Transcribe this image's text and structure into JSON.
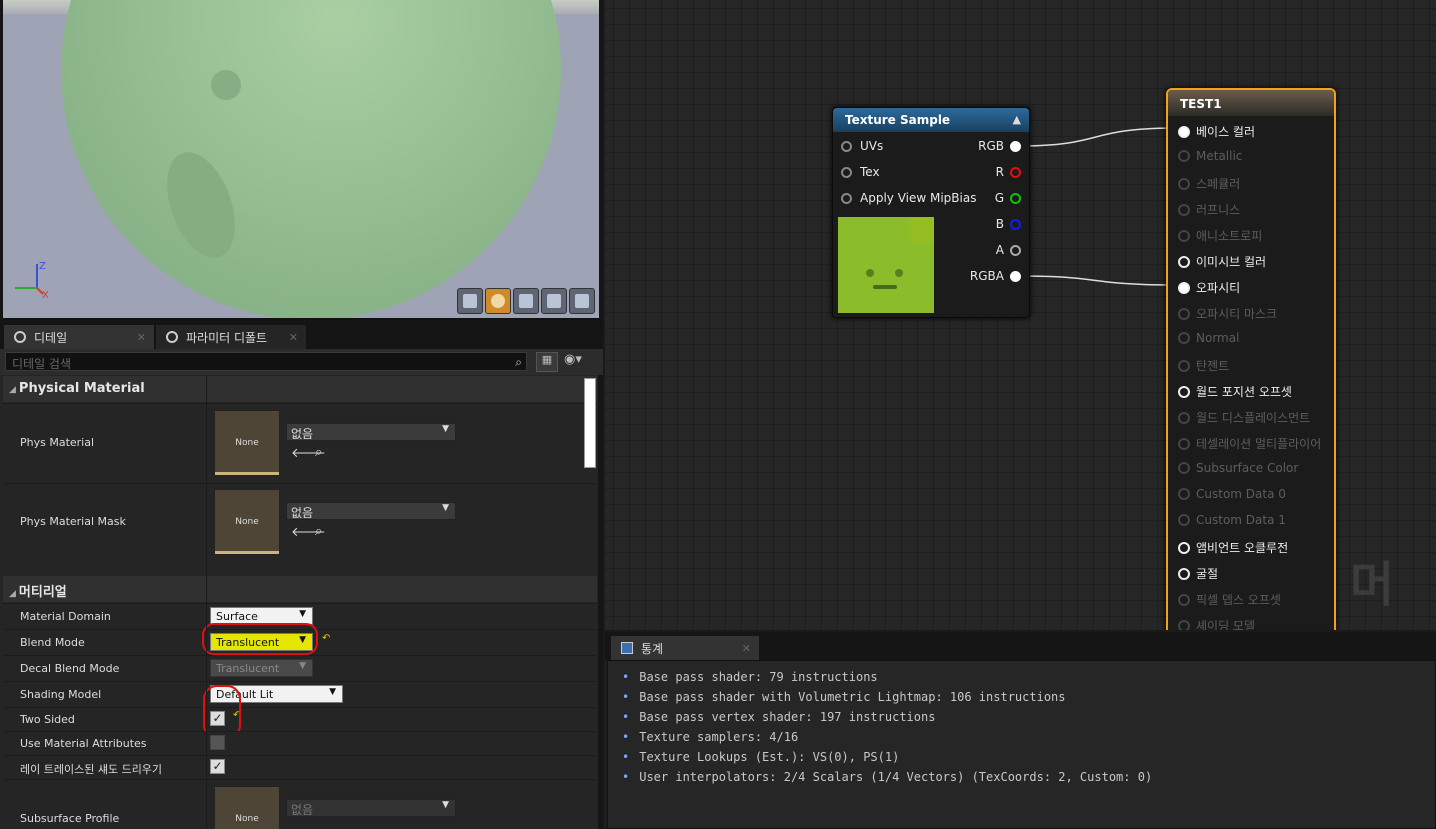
{
  "viewport": {
    "axis_z": "Z",
    "axis_x": "X",
    "buttons": [
      "cylinder-icon",
      "sphere-icon",
      "plane-icon",
      "cube-icon",
      "teapot-icon"
    ]
  },
  "tabs": [
    {
      "label": "디테일"
    },
    {
      "label": "파라미터 디폴트"
    }
  ],
  "search": {
    "placeholder": "디테일 검색"
  },
  "categories": {
    "physical": "Physical Material",
    "material": "머티리얼"
  },
  "physical": {
    "phys_material": {
      "label": "Phys Material",
      "thumb": "None",
      "value": "없음"
    },
    "phys_material_mask": {
      "label": "Phys Material Mask",
      "thumb": "None",
      "value": "없음"
    }
  },
  "material": {
    "domain": {
      "label": "Material Domain",
      "value": "Surface"
    },
    "blend": {
      "label": "Blend Mode",
      "value": "Translucent"
    },
    "decal": {
      "label": "Decal Blend Mode",
      "value": "Translucent"
    },
    "shading": {
      "label": "Shading Model",
      "value": "Default Lit"
    },
    "two_sided": {
      "label": "Two Sided",
      "checked": true
    },
    "use_attr": {
      "label": "Use Material Attributes",
      "checked": false
    },
    "ray_shadow": {
      "label": "레이 트레이스된 섀도 드리우기",
      "checked": true
    },
    "subsurface": {
      "label": "Subsurface Profile",
      "thumb": "None",
      "value": "없음"
    }
  },
  "texture_node": {
    "title": "Texture Sample",
    "inputs": [
      "UVs",
      "Tex",
      "Apply View MipBias"
    ],
    "outputs": [
      {
        "label": "RGB",
        "color": "#ffffff"
      },
      {
        "label": "R",
        "color": "#e01010"
      },
      {
        "label": "G",
        "color": "#10c010"
      },
      {
        "label": "B",
        "color": "#1020e0"
      },
      {
        "label": "A",
        "color": "#aaaaaa"
      },
      {
        "label": "RGBA",
        "color": "#ffffff"
      }
    ]
  },
  "material_node": {
    "title": "TEST1",
    "pins": [
      {
        "label": "베이스 컬러",
        "state": "connected"
      },
      {
        "label": "Metallic",
        "state": "disabled"
      },
      {
        "label": "스페큘러",
        "state": "disabled"
      },
      {
        "label": "러프니스",
        "state": "disabled"
      },
      {
        "label": "애니소트로피",
        "state": "disabled"
      },
      {
        "label": "이미시브 컬러",
        "state": "enabled"
      },
      {
        "label": "오파시티",
        "state": "connected"
      },
      {
        "label": "오파시티 마스크",
        "state": "disabled"
      },
      {
        "label": "Normal",
        "state": "disabled"
      },
      {
        "label": "탄젠트",
        "state": "disabled"
      },
      {
        "label": "월드 포지션 오프셋",
        "state": "enabled"
      },
      {
        "label": "월드 디스플레이스먼트",
        "state": "disabled"
      },
      {
        "label": "테셀레이션 멀티플라이어",
        "state": "disabled"
      },
      {
        "label": "Subsurface Color",
        "state": "disabled"
      },
      {
        "label": "Custom Data 0",
        "state": "disabled"
      },
      {
        "label": "Custom Data 1",
        "state": "disabled"
      },
      {
        "label": "앰비언트 오클루전",
        "state": "enabled"
      },
      {
        "label": "굴절",
        "state": "enabled"
      },
      {
        "label": "픽셀 뎁스 오프셋",
        "state": "disabled"
      },
      {
        "label": "셰이딩 모델",
        "state": "disabled"
      }
    ]
  },
  "watermark": "머티",
  "stats": {
    "tab": "통계",
    "lines": [
      "Base pass shader: 79 instructions",
      "Base pass shader with Volumetric Lightmap: 106 instructions",
      "Base pass vertex shader: 197 instructions",
      "Texture samplers: 4/16",
      "Texture Lookups (Est.): VS(0), PS(1)",
      "User interpolators: 2/4 Scalars (1/4 Vectors) (TexCoords: 2, Custom: 0)"
    ]
  }
}
